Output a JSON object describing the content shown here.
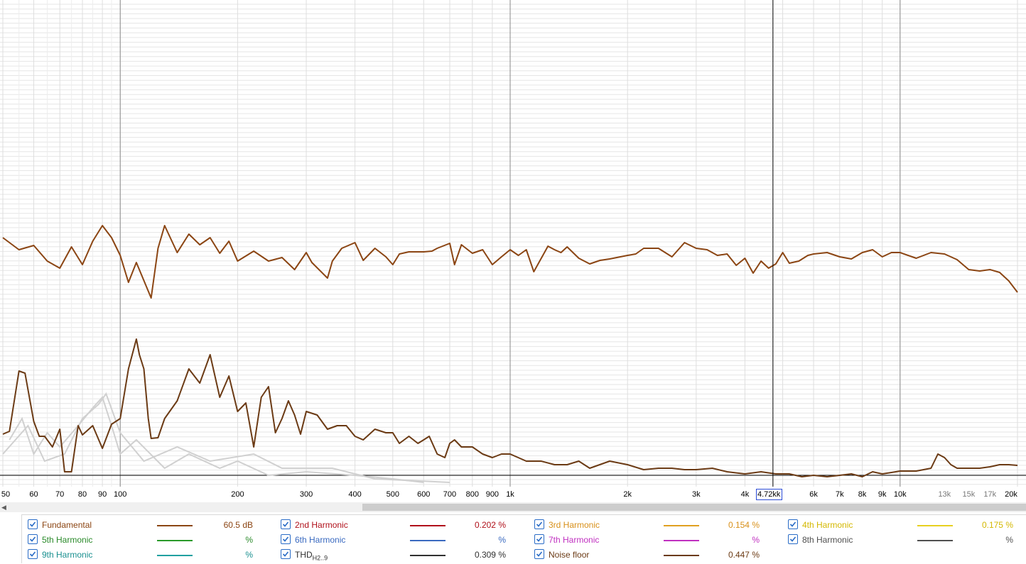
{
  "chart_data": {
    "type": "line",
    "x_scale": "log",
    "xlim": [
      50,
      21000
    ],
    "grid": true,
    "x_tick_labels": [
      "50",
      "60",
      "70",
      "80",
      "90",
      "100",
      "200",
      "300",
      "400",
      "500",
      "600",
      "700",
      "800",
      "900",
      "1k",
      "2k",
      "3k",
      "4k",
      "6k",
      "7k",
      "8k",
      "9k",
      "10k",
      "13k",
      "15k",
      "17k",
      "20k"
    ],
    "cursor": {
      "label": "4.72kk",
      "freq": 4720
    },
    "series": [
      {
        "name": "Fundamental",
        "color": "#8b4513",
        "x": [
          50,
          55,
          60,
          65,
          70,
          75,
          80,
          85,
          90,
          95,
          100,
          105,
          110,
          120,
          125,
          130,
          140,
          150,
          160,
          170,
          180,
          190,
          200,
          220,
          240,
          260,
          280,
          300,
          310,
          340,
          350,
          370,
          400,
          420,
          450,
          480,
          500,
          520,
          550,
          600,
          630,
          650,
          700,
          720,
          750,
          800,
          850,
          900,
          950,
          1000,
          1050,
          1100,
          1150,
          1250,
          1300,
          1350,
          1400,
          1500,
          1600,
          1700,
          1800,
          2000,
          2100,
          2200,
          2400,
          2600,
          2800,
          3000,
          3200,
          3400,
          3600,
          3800,
          4000,
          4200,
          4400,
          4600,
          4800,
          5000,
          5200,
          5500,
          5800,
          6000,
          6500,
          7000,
          7500,
          8000,
          8500,
          9000,
          9500,
          10000,
          11000,
          12000,
          13000,
          14000,
          15000,
          16000,
          17000,
          18000,
          19000,
          20000
        ],
        "values": [
          335,
          352,
          346,
          368,
          378,
          348,
          373,
          340,
          318,
          335,
          360,
          398,
          370,
          420,
          350,
          318,
          356,
          330,
          345,
          335,
          357,
          340,
          368,
          354,
          368,
          363,
          380,
          356,
          370,
          392,
          368,
          350,
          342,
          367,
          350,
          362,
          373,
          358,
          355,
          355,
          354,
          350,
          343,
          373,
          345,
          357,
          352,
          373,
          362,
          352,
          360,
          352,
          383,
          347,
          352,
          356,
          348,
          364,
          372,
          367,
          365,
          360,
          358,
          350,
          350,
          362,
          342,
          350,
          352,
          360,
          358,
          374,
          364,
          385,
          368,
          378,
          372,
          356,
          371,
          368,
          360,
          358,
          356,
          362,
          365,
          356,
          352,
          362,
          356,
          356,
          364,
          356,
          358,
          366,
          380,
          382,
          380,
          384,
          396,
          412
        ]
      },
      {
        "name": "Noise floor",
        "color": "#6b3a14",
        "x": [
          50,
          52,
          55,
          57,
          60,
          62,
          64,
          67,
          70,
          72,
          75,
          78,
          80,
          85,
          90,
          95,
          100,
          105,
          110,
          112,
          115,
          118,
          120,
          125,
          130,
          140,
          150,
          160,
          170,
          180,
          190,
          200,
          210,
          220,
          230,
          240,
          250,
          260,
          270,
          280,
          290,
          300,
          320,
          340,
          360,
          380,
          400,
          420,
          450,
          480,
          500,
          520,
          550,
          580,
          600,
          620,
          650,
          680,
          700,
          720,
          750,
          800,
          850,
          900,
          950,
          1000,
          1100,
          1200,
          1300,
          1400,
          1500,
          1600,
          1800,
          2000,
          2200,
          2400,
          2600,
          2800,
          3000,
          3300,
          3600,
          4000,
          4400,
          4800,
          5200,
          5600,
          6000,
          6500,
          7000,
          7500,
          8000,
          8500,
          9000,
          9500,
          10000,
          11000,
          12000,
          12500,
          13000,
          13500,
          14000,
          15000,
          16000,
          17000,
          18000,
          19000,
          20000
        ],
        "values": [
          612,
          608,
          523,
          526,
          594,
          615,
          615,
          630,
          605,
          665,
          665,
          600,
          613,
          600,
          632,
          598,
          590,
          520,
          478,
          500,
          520,
          590,
          618,
          617,
          590,
          565,
          520,
          540,
          500,
          560,
          530,
          580,
          568,
          630,
          560,
          545,
          610,
          590,
          565,
          585,
          612,
          580,
          585,
          605,
          600,
          600,
          615,
          620,
          605,
          610,
          610,
          625,
          615,
          625,
          620,
          615,
          640,
          645,
          625,
          620,
          630,
          630,
          640,
          645,
          640,
          640,
          650,
          650,
          655,
          655,
          650,
          660,
          650,
          655,
          662,
          660,
          660,
          662,
          662,
          660,
          665,
          668,
          665,
          668,
          668,
          672,
          670,
          672,
          670,
          668,
          672,
          665,
          668,
          666,
          664,
          664,
          660,
          640,
          645,
          655,
          660,
          660,
          660,
          658,
          655,
          655,
          656
        ]
      },
      {
        "name": "2nd Harmonic",
        "color": "#b0101a",
        "x": [],
        "values": []
      },
      {
        "name": "3rd Harmonic",
        "color": "#e0a020",
        "x": [],
        "values": []
      },
      {
        "name": "4th Harmonic",
        "color": "#e8d020",
        "x": [],
        "values": []
      },
      {
        "name": "5th Harmonic",
        "color": "#2a9a2a",
        "x": [],
        "values": []
      },
      {
        "name": "6th Harmonic",
        "color": "#3a6ac0",
        "x": [],
        "values": []
      },
      {
        "name": "7th Harmonic",
        "color": "#c030c0",
        "x": [],
        "values": []
      },
      {
        "name": "8th Harmonic",
        "color": "#505050",
        "x": [],
        "values": []
      },
      {
        "name": "9th Harmonic",
        "color": "#20a0a0",
        "x": [],
        "values": []
      },
      {
        "name": "THD",
        "color": "#404040",
        "x": [],
        "values": []
      }
    ],
    "background_traces_color": "#d0d0d0"
  },
  "legend": {
    "rows": [
      [
        {
          "label": "Fundamental",
          "label_color": "#8b4513",
          "swatch": "#8b4513",
          "value": "60.5 dB",
          "value_color": "#8b4513"
        },
        {
          "label": "2nd Harmonic",
          "label_color": "#b0101a",
          "swatch": "#b0101a",
          "value": "0.202 %",
          "value_color": "#b0101a"
        },
        {
          "label": "3rd Harmonic",
          "label_color": "#d8901a",
          "swatch": "#e0a020",
          "value": "0.154 %",
          "value_color": "#d8901a"
        },
        {
          "label": "4th Harmonic",
          "label_color": "#d4b800",
          "swatch": "#e8d020",
          "value": "0.175 %",
          "value_color": "#d4b800"
        }
      ],
      [
        {
          "label": "5th Harmonic",
          "label_color": "#2a8a2a",
          "swatch": "#2a9a2a",
          "value": "%",
          "value_color": "#2a8a2a"
        },
        {
          "label": "6th Harmonic",
          "label_color": "#3a6ac0",
          "swatch": "#3a6ac0",
          "value": "%",
          "value_color": "#3a6ac0"
        },
        {
          "label": "7th Harmonic",
          "label_color": "#c030c0",
          "swatch": "#c030c0",
          "value": "%",
          "value_color": "#c030c0"
        },
        {
          "label": "8th Harmonic",
          "label_color": "#505050",
          "swatch": "#505050",
          "value": "%",
          "value_color": "#505050"
        }
      ],
      [
        {
          "label": "9th Harmonic",
          "label_color": "#1a9090",
          "swatch": "#20a0a0",
          "value": "%",
          "value_color": "#1a9090"
        },
        {
          "label": "THD",
          "sub": "H2..9",
          "label_color": "#303030",
          "swatch": "#303030",
          "value": "0.309 %",
          "value_color": "#303030"
        },
        {
          "label": "Noise floor",
          "label_color": "#6b3a14",
          "swatch": "#6b3a14",
          "value": "0.447 %",
          "value_color": "#6b3a14"
        }
      ]
    ]
  }
}
